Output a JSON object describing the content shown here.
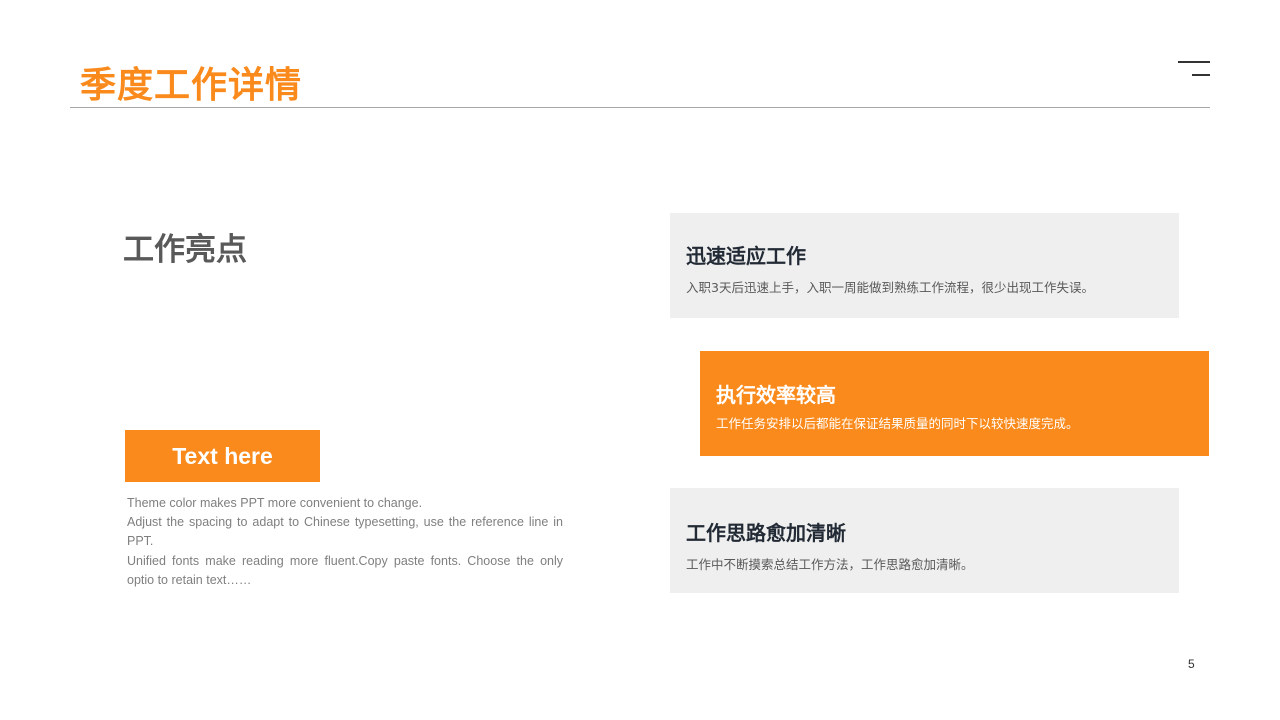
{
  "slide": {
    "title": "季度工作详情",
    "page_number": "5"
  },
  "left": {
    "heading": "工作亮点",
    "button_label": "Text here",
    "description": [
      "Theme  color makes PPT more convenient  to change.",
      "Adjust the spacing to adapt to Chinese typesetting, use the reference line in PPT.",
      "Unified  fonts make reading more fluent.Copy paste fonts. Choose the only optio to retain text……"
    ]
  },
  "cards": [
    {
      "title": "迅速适应工作",
      "body": "入职3天后迅速上手，入职一周能做到熟练工作流程，很少出现工作失误。",
      "style": "gray"
    },
    {
      "title": "执行效率较高",
      "body": "工作任务安排以后都能在保证结果质量的同时下以较快速度完成。",
      "style": "orange"
    },
    {
      "title": "工作思路愈加清晰",
      "body": "工作中不断摸索总结工作方法，工作思路愈加清晰。",
      "style": "gray"
    }
  ],
  "icons": {
    "top_right": "menu-icon"
  },
  "colors": {
    "accent": "#F98A1B",
    "card_gray": "#EFEFEF",
    "heading_gray": "#595959",
    "card_title_dark": "#222A35"
  }
}
